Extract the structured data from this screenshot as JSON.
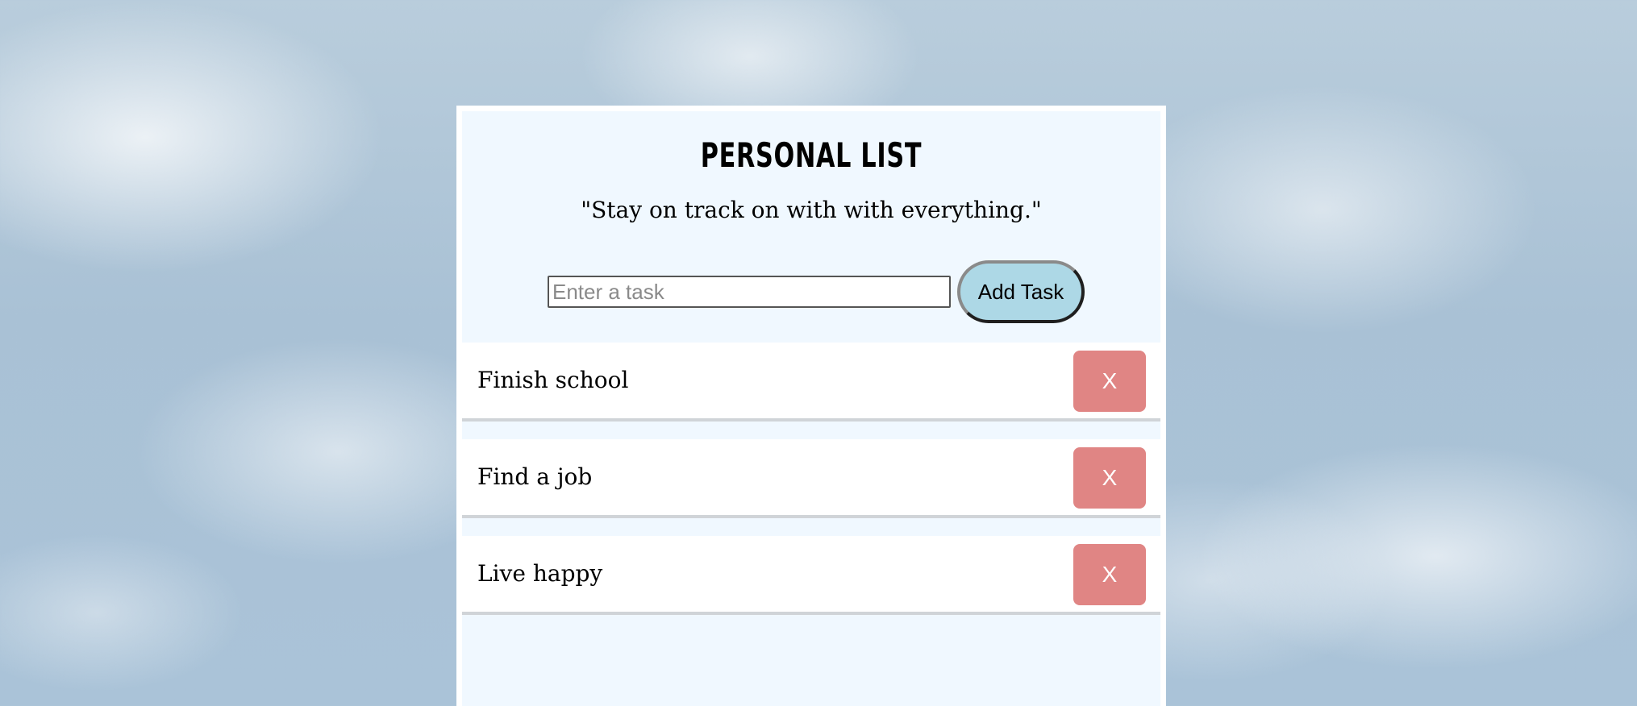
{
  "header": {
    "title": "PERSONAL LIST",
    "subtitle": "\"Stay on track on with with everything.\""
  },
  "form": {
    "input_placeholder": "Enter a task",
    "input_value": "",
    "add_button_label": "Add Task"
  },
  "tasks": [
    {
      "label": "Finish school",
      "delete_label": "X"
    },
    {
      "label": "Find a job",
      "delete_label": "X"
    },
    {
      "label": "Live happy",
      "delete_label": "X"
    }
  ],
  "colors": {
    "card_background": "#f0f8ff",
    "add_button": "#add8e6",
    "delete_button": "#e08584"
  }
}
